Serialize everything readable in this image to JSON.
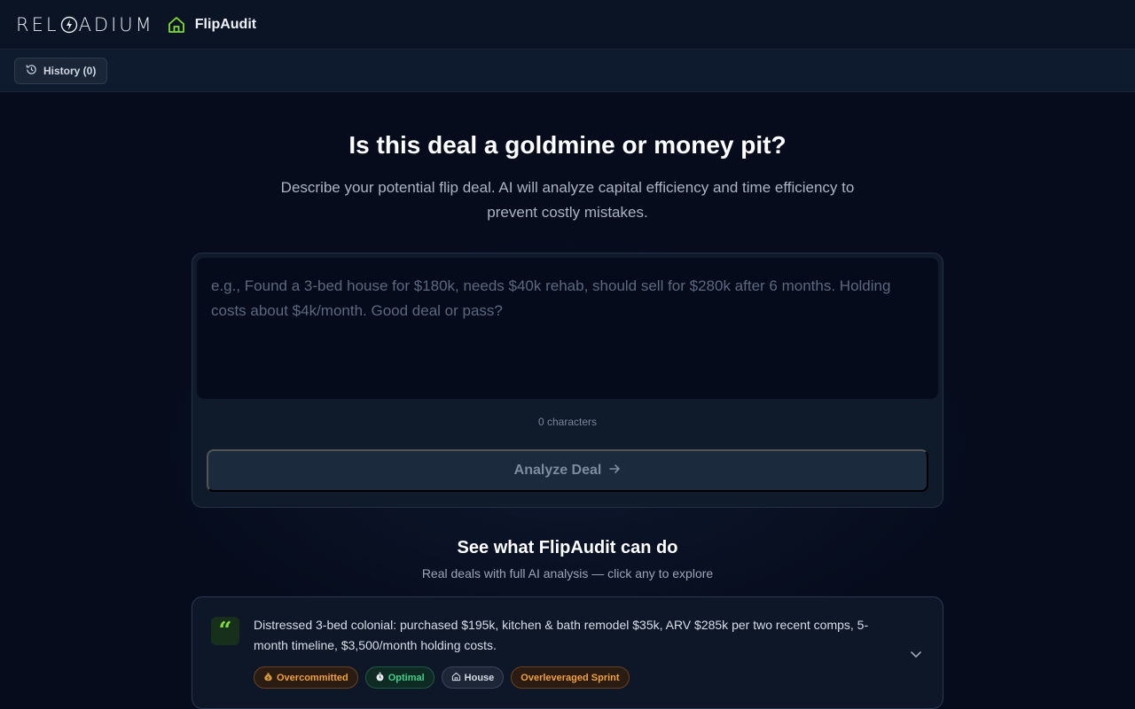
{
  "header": {
    "brand_left": "REL",
    "brand_right": "ADIUM",
    "app_name": "FlipAudit"
  },
  "toolbar": {
    "history_label": "History (0)"
  },
  "hero": {
    "headline": "Is this deal a goldmine or money pit?",
    "subhead": "Describe your potential flip deal. AI will analyze capital efficiency and time efficiency to prevent costly mistakes."
  },
  "input": {
    "value": "",
    "placeholder": "e.g., Found a 3-bed house for $180k, needs $40k rehab, should sell for $280k after 6 months. Holding costs about $4k/month. Good deal or pass?",
    "char_count": "0 characters",
    "analyze_label": "Analyze Deal"
  },
  "examples": {
    "title": "See what FlipAudit can do",
    "subtitle": "Real deals with full AI analysis — click any to explore",
    "items": [
      {
        "text": "Distressed 3-bed colonial: purchased $195k, kitchen & bath remodel $35k, ARV $285k per two recent comps, 5-month timeline, $3,500/month holding costs.",
        "tags": [
          {
            "label": "Overcommitted",
            "icon": "money-bag-icon"
          },
          {
            "label": "Optimal",
            "icon": "stopwatch-icon"
          },
          {
            "label": "House",
            "icon": "home-icon"
          },
          {
            "label": "Overleveraged Sprint",
            "icon": ""
          }
        ]
      }
    ]
  },
  "colors": {
    "accent_green": "#7fdc3a",
    "warning_orange": "#f0a040",
    "success_green": "#3fd08a"
  }
}
